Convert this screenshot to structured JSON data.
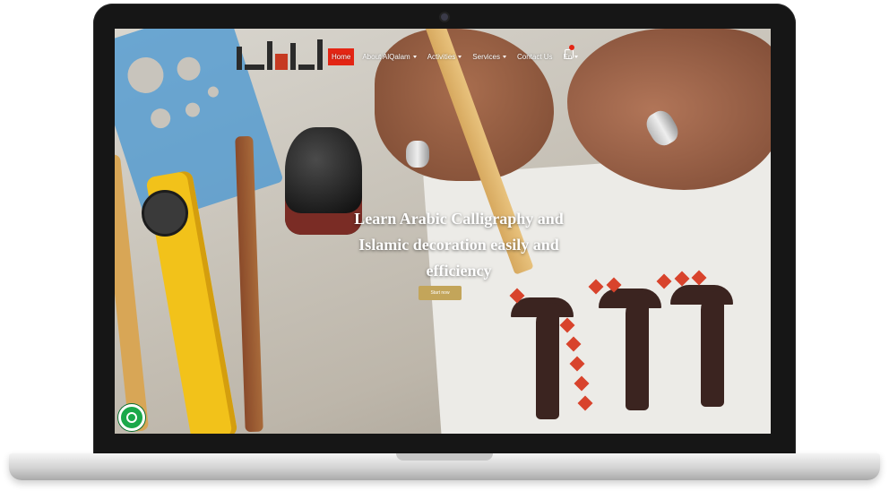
{
  "site": {
    "logo_text": "القلم",
    "nav": {
      "items": [
        {
          "label": "Home",
          "active": true,
          "dropdown": false
        },
        {
          "label": "About AlQalam",
          "active": false,
          "dropdown": true
        },
        {
          "label": "Activities",
          "active": false,
          "dropdown": true
        },
        {
          "label": "Services",
          "active": false,
          "dropdown": true
        },
        {
          "label": "Contact Us",
          "active": false,
          "dropdown": false
        },
        {
          "label": "En",
          "active": false,
          "dropdown": true
        }
      ],
      "cart_icon": "shopping-bag-icon"
    },
    "hero": {
      "line1": "Learn Arabic Calligraphy and",
      "line2": "Islamic decoration easily and",
      "line3": "efficiency",
      "cta_label": "Start now"
    },
    "float_button_icon": "whatsapp-icon"
  },
  "colors": {
    "accent_red": "#e32514",
    "cta_gold": "#c3a55a",
    "float_green": "#1aa84a",
    "bezel": "#161616"
  }
}
